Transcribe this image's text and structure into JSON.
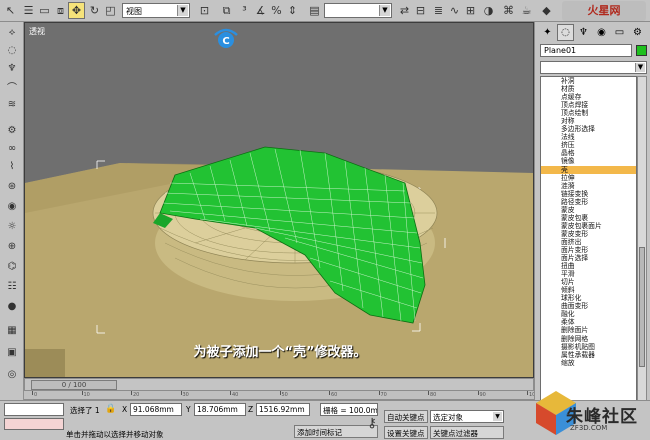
{
  "toolbar": {
    "view_select": "视图",
    "logo_text": "火星网"
  },
  "viewport": {
    "label": "透视",
    "caption": "为被子添加一个“壳”修改器。",
    "badge_letter": "C"
  },
  "time_slider": {
    "label": "0 / 100",
    "ticks": [
      "0",
      "10",
      "20",
      "30",
      "40",
      "50",
      "60",
      "70",
      "80",
      "90",
      "100"
    ]
  },
  "right_panel": {
    "object_name": "Plane01",
    "object_color": "#1ec01e",
    "modifiers": [
      "补洞",
      "材质",
      "点缓存",
      "顶点焊接",
      "顶点绘制",
      "对称",
      "多边形选择",
      "法线",
      "挤压",
      "晶格",
      "镜像",
      "壳",
      "拉伸",
      "涟漪",
      "链接变换",
      "路径变形",
      "蒙皮",
      "蒙皮包裹",
      "蒙皮包裹面片",
      "蒙皮变形",
      "面挤出",
      "面片变形",
      "面片选择",
      "扭曲",
      "平滑",
      "切片",
      "倾斜",
      "球形化",
      "曲面变形",
      "融化",
      "柔体",
      "删除面片",
      "删除网格",
      "摄影机贴图",
      "属性承载器",
      "缩放"
    ],
    "selected_modifier": "壳"
  },
  "status": {
    "selection_text": "选择了 1",
    "x_label": "X",
    "x_value": "91.068mm",
    "y_label": "Y",
    "y_value": "18.706mm",
    "z_label": "Z",
    "z_value": "1516.92mm",
    "grid_text": "栅格 = 100.0mm",
    "auto_key": "自动关键点",
    "set_key": "设置关键点",
    "selected_objects": "选定对象",
    "key_filters": "关键点过滤器",
    "prompt": "单击并拖动以选择并移动对象",
    "add_time_tag": "添加时间标记",
    "site_name": "朱峰社区",
    "site_url": "ZF3D.COM"
  },
  "colors": {
    "selected_modifier": "#f3b84a",
    "cloth_green": "#22c233",
    "pillow": "#d9cc98",
    "floor": "#b9a76e"
  }
}
